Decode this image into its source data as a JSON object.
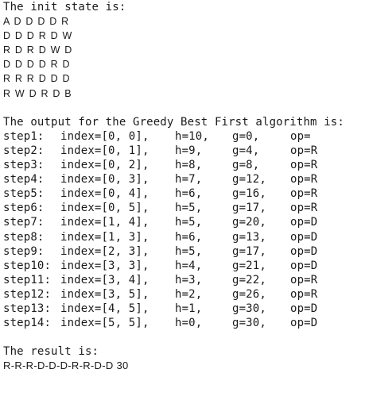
{
  "init_title": "The init state is:",
  "grid_rows": [
    "A D D D D R",
    "D D D R D W",
    "R D R D W D",
    "D D D D R D",
    "R R R D D D",
    "R W D R D B"
  ],
  "output_title": "The output for the Greedy Best First algorithm is:",
  "steps": [
    {
      "step": "step1:",
      "index": "index=[0, 0],",
      "h": "h=10,",
      "g": "g=0,",
      "op": "op="
    },
    {
      "step": "step2:",
      "index": "index=[0, 1],",
      "h": "h=9,",
      "g": "g=4,",
      "op": "op=R"
    },
    {
      "step": "step3:",
      "index": "index=[0, 2],",
      "h": "h=8,",
      "g": "g=8,",
      "op": "op=R"
    },
    {
      "step": "step4:",
      "index": "index=[0, 3],",
      "h": "h=7,",
      "g": "g=12,",
      "op": "op=R"
    },
    {
      "step": "step5:",
      "index": "index=[0, 4],",
      "h": "h=6,",
      "g": "g=16,",
      "op": "op=R"
    },
    {
      "step": "step6:",
      "index": "index=[0, 5],",
      "h": "h=5,",
      "g": "g=17,",
      "op": "op=R"
    },
    {
      "step": "step7:",
      "index": "index=[1, 4],",
      "h": "h=5,",
      "g": "g=20,",
      "op": "op=D"
    },
    {
      "step": "step8:",
      "index": "index=[1, 3],",
      "h": "h=6,",
      "g": "g=13,",
      "op": "op=D"
    },
    {
      "step": "step9:",
      "index": "index=[2, 3],",
      "h": "h=5,",
      "g": "g=17,",
      "op": "op=D"
    },
    {
      "step": "step10:",
      "index": "index=[3, 3],",
      "h": "h=4,",
      "g": "g=21,",
      "op": "op=D"
    },
    {
      "step": "step11:",
      "index": "index=[3, 4],",
      "h": "h=3,",
      "g": "g=22,",
      "op": "op=R"
    },
    {
      "step": "step12:",
      "index": "index=[3, 5],",
      "h": "h=2,",
      "g": "g=26,",
      "op": "op=R"
    },
    {
      "step": "step13:",
      "index": "index=[4, 5],",
      "h": "h=1,",
      "g": "g=30,",
      "op": "op=D"
    },
    {
      "step": "step14:",
      "index": "index=[5, 5],",
      "h": "h=0,",
      "g": "g=30,",
      "op": "op=D"
    }
  ],
  "result_title": "The result is:",
  "result_path": "R-R-R-D-D-D-R-R-D-D 30"
}
